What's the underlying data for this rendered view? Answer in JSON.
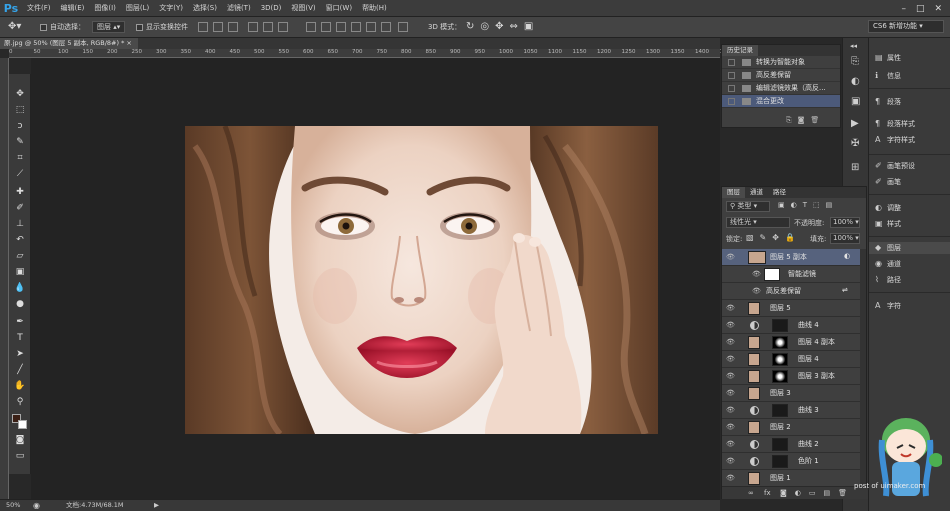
{
  "app": {
    "logo": "Ps"
  },
  "menu": [
    "文件(F)",
    "编辑(E)",
    "图像(I)",
    "图层(L)",
    "文字(Y)",
    "选择(S)",
    "滤镜(T)",
    "3D(D)",
    "视图(V)",
    "窗口(W)",
    "帮助(H)"
  ],
  "window_controls": [
    "–",
    "□",
    "✕"
  ],
  "options": {
    "auto_select_label": "自动选择：",
    "auto_select_value": "图层",
    "show_transform_label": "显示变换控件",
    "mode_3d_label": "3D 模式：",
    "workspace": "CS6 新增功能"
  },
  "document": {
    "tab_title": "原.jpg @ 50% (图层 5 副本, RGB/8#) *",
    "close": "×"
  },
  "ruler_ticks": [
    "0",
    "50",
    "100",
    "150",
    "200",
    "250",
    "300",
    "350",
    "400",
    "450",
    "500",
    "550",
    "600",
    "650",
    "700",
    "750",
    "800",
    "850",
    "900",
    "950",
    "1000",
    "1050",
    "1100",
    "1150",
    "1200",
    "1250",
    "1300",
    "1350",
    "1400",
    "1450"
  ],
  "status": {
    "zoom": "50%",
    "doc": "文档:4.73M/68.1M"
  },
  "history": {
    "tab": "历史记录",
    "items": [
      "转换为智能对象",
      "高反差保留",
      "编辑滤镜效果（高反...",
      "混合更改"
    ],
    "active_index": 3
  },
  "layers": {
    "tabs": [
      "图层",
      "通道",
      "路径"
    ],
    "filter_label": "类型",
    "blend_mode": "线性光",
    "opacity_label": "不透明度:",
    "opacity": "100%",
    "lock_label": "锁定:",
    "fill_label": "填充:",
    "fill": "100%",
    "rows": [
      {
        "name": "图层 5 副本",
        "kind": "smart",
        "selected": true
      },
      {
        "name": "智能滤镜",
        "kind": "smartfilter"
      },
      {
        "name": "高反差保留",
        "kind": "filter"
      },
      {
        "name": "图层 5",
        "kind": "photo"
      },
      {
        "name": "曲线 4",
        "kind": "adj"
      },
      {
        "name": "图层 4 副本",
        "kind": "photo-mask"
      },
      {
        "name": "图层 4",
        "kind": "photo-mask"
      },
      {
        "name": "图层 3 副本",
        "kind": "photo-mask"
      },
      {
        "name": "图层 3",
        "kind": "photo"
      },
      {
        "name": "曲线 3",
        "kind": "adj"
      },
      {
        "name": "图层 2",
        "kind": "photo"
      },
      {
        "name": "曲线 2",
        "kind": "adj"
      },
      {
        "name": "色阶 1",
        "kind": "adj"
      },
      {
        "name": "图层 1",
        "kind": "photo"
      }
    ],
    "footer_icons": [
      "∞",
      "fx"
    ]
  },
  "right_panel": {
    "items": [
      "属性",
      "信息",
      "段落",
      "段落样式",
      "字符样式",
      "画笔预设",
      "画笔",
      "调整",
      "样式",
      "图层",
      "通道",
      "路径",
      "字符"
    ]
  },
  "watermark": "post of uimaker.com"
}
